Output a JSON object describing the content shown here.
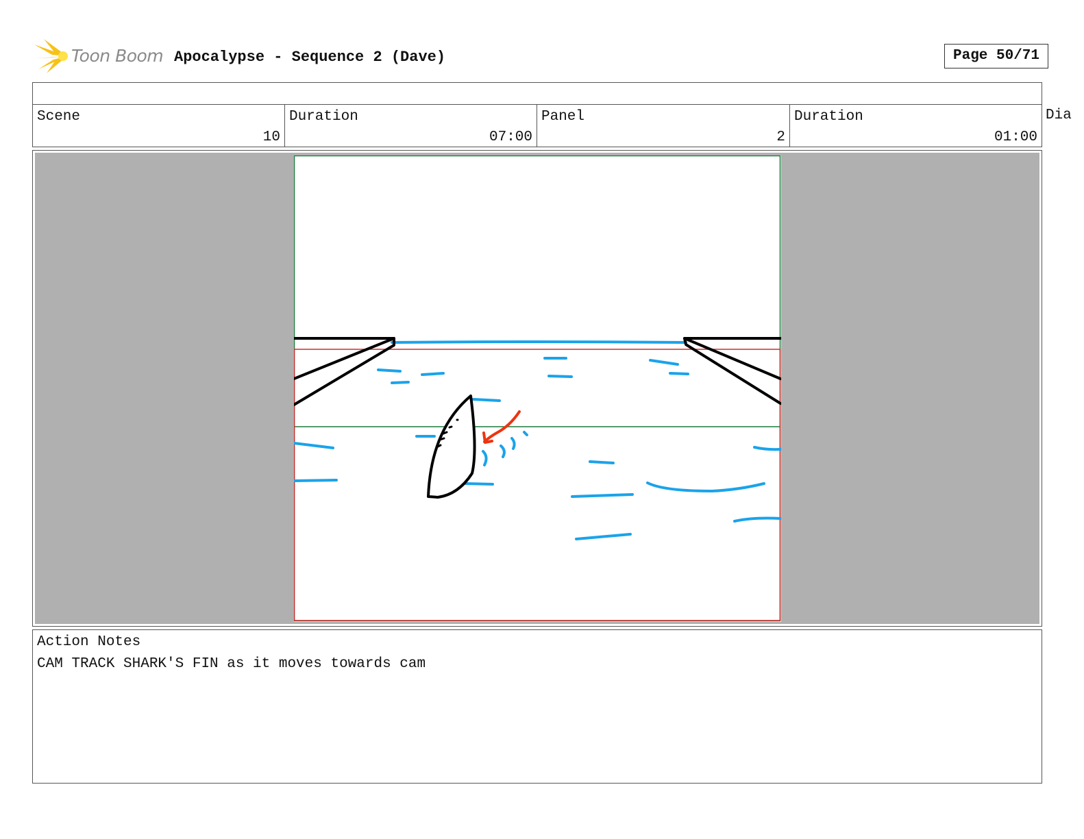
{
  "header": {
    "brand": "Toon Boom",
    "title": "Apocalypse - Sequence 2 (Dave)",
    "page": "Page 50/71"
  },
  "info": {
    "scene_label": "Scene",
    "scene_value": "10",
    "scene_duration_label": "Duration",
    "scene_duration_value": "07:00",
    "panel_label": "Panel",
    "panel_value": "2",
    "panel_duration_label": "Duration",
    "panel_duration_value": "01:00",
    "dialog_label_cut": "Dia"
  },
  "notes": {
    "label": "Action Notes",
    "text": "CAM TRACK SHARK'S FIN as it moves towards cam"
  },
  "colors": {
    "water": "#1aa3ea",
    "ink": "#000000",
    "arrow": "#ee3311",
    "camera_frame": "#1a7a3a",
    "safe_frame": "#cc2b2b",
    "gray_bg": "#b0b0b0"
  }
}
